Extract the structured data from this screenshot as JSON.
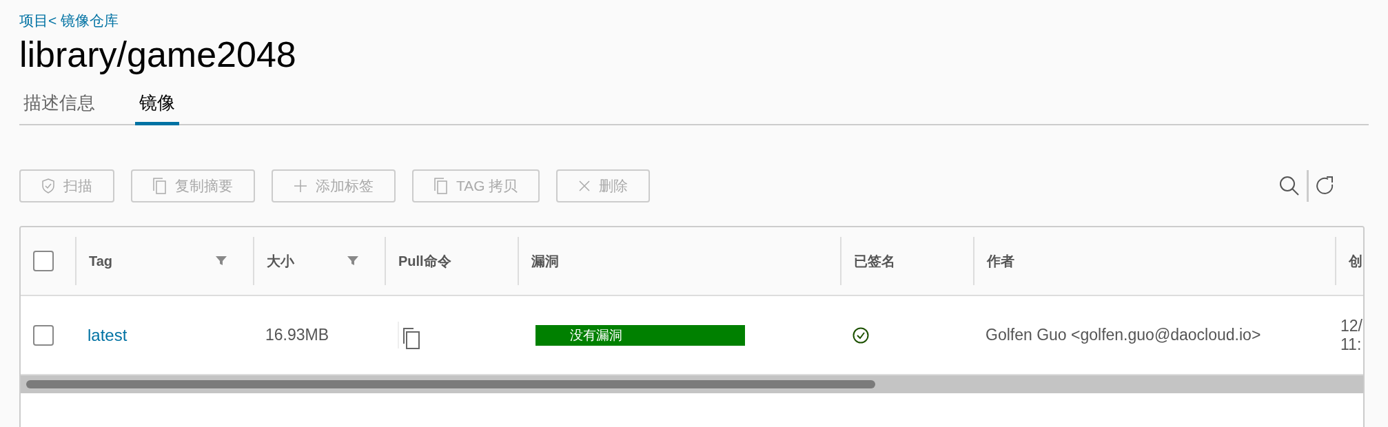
{
  "breadcrumb": {
    "text": "项目< 镜像仓库"
  },
  "title": "library/game2048",
  "tabs": [
    {
      "label": "描述信息",
      "selected": false
    },
    {
      "label": "镜像",
      "selected": true
    }
  ],
  "toolbar": [
    {
      "label": "扫描",
      "kind": "shield",
      "disabled": true
    },
    {
      "label": "复制摘要",
      "kind": "copy",
      "disabled": true
    },
    {
      "label": "添加标签",
      "kind": "plus",
      "disabled": true
    },
    {
      "label": "TAG 拷贝",
      "kind": "copy",
      "disabled": true
    },
    {
      "label": "删除",
      "kind": "close",
      "disabled": true
    }
  ],
  "table": {
    "select_all": {
      "checked": false
    },
    "columns": [
      {
        "label": "Tag",
        "filter": true
      },
      {
        "label": "大小",
        "filter": true
      },
      {
        "label": "Pull命令",
        "filter": false
      },
      {
        "label": "漏洞",
        "filter": false
      },
      {
        "label": "已签名",
        "filter": false
      },
      {
        "label": "作者",
        "filter": false
      },
      {
        "label": "创"
      }
    ],
    "rows": [
      {
        "checked": false,
        "tag": "latest",
        "size": "16.93MB",
        "vulnerability": "没有漏洞",
        "signed": true,
        "author": "Golfen Guo <golfen.guo@daocloud.io>",
        "created": [
          "12/",
          "11:"
        ]
      }
    ]
  }
}
